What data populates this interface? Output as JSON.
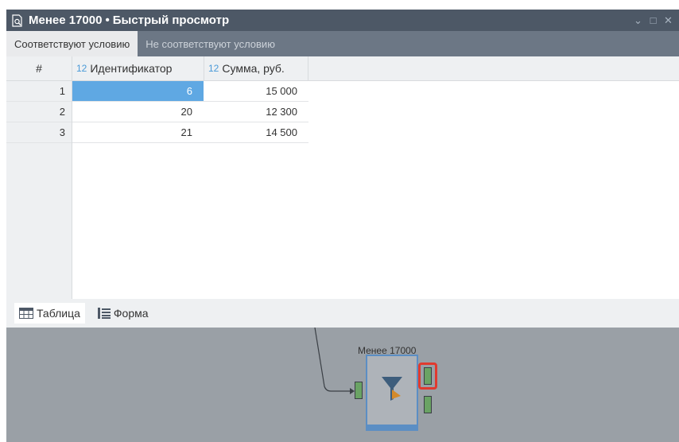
{
  "window": {
    "title": "Менее 17000",
    "title_separator": "•",
    "subtitle": "Быстрый просмотр",
    "controls": [
      "chevron-down-icon",
      "maximize-icon",
      "close-icon"
    ]
  },
  "tabs": [
    {
      "label": "Соответствуют условию",
      "active": true
    },
    {
      "label": "Не соответствуют условию",
      "active": false
    }
  ],
  "table": {
    "columns": [
      {
        "type": "",
        "label": "#"
      },
      {
        "type": "12",
        "label": "Идентификатор"
      },
      {
        "type": "12",
        "label": "Сумма, руб."
      }
    ],
    "rows": [
      {
        "num": "1",
        "id": "6",
        "sum": "15 000",
        "selected": true
      },
      {
        "num": "2",
        "id": "20",
        "sum": "12 300",
        "selected": false
      },
      {
        "num": "3",
        "id": "21",
        "sum": "14 500",
        "selected": false
      }
    ]
  },
  "view_modes": [
    {
      "label": "Таблица",
      "icon": "table-icon",
      "active": true
    },
    {
      "label": "Форма",
      "icon": "form-icon",
      "active": false
    }
  ],
  "canvas": {
    "node_label": "Менее 17000",
    "node_icon": "filter-icon"
  },
  "colors": {
    "titlebar": "#4d5866",
    "tabbar": "#6c7785",
    "selection": "#5fa8e3",
    "canvas": "#9aa0a6",
    "node_accent": "#5b8ec4",
    "highlight": "#e03a2f"
  }
}
